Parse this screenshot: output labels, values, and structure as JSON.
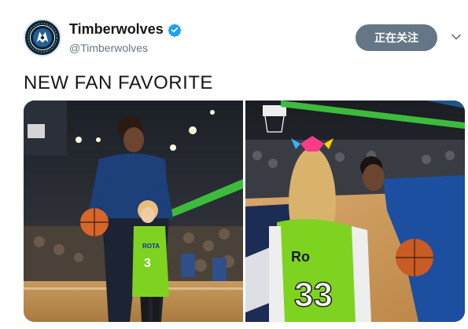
{
  "tweet": {
    "display_name": "Timberwolves",
    "handle": "@Timberwolves",
    "text": "NEW FAN FAVORITE",
    "follow_label": "正在关注",
    "verified_icon": "verified-badge-icon",
    "menu_icon": "chevron-down-icon"
  },
  "photos": [
    {
      "jersey_name": "ROTA",
      "jersey_number": "3"
    },
    {
      "jersey_name": "Ro",
      "jersey_number": "33"
    }
  ],
  "colors": {
    "follow_button": "#657786",
    "verified": "#1da1f2",
    "text": "#14171a",
    "secondary": "#657786",
    "jersey_green": "#7ed321",
    "team_navy": "#0c2340"
  }
}
